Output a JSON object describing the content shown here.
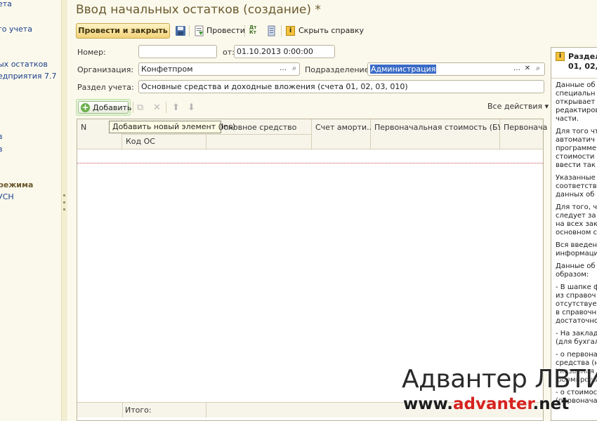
{
  "left_nav": {
    "items": [
      "ета",
      "го учета",
      "ых остатков",
      "едприятия 7.7",
      "в",
      "в"
    ],
    "section": "режима",
    "section_item": "УСН"
  },
  "form": {
    "title": "Ввод начальных остатков (создание) *",
    "toolbar": {
      "post_close": "Провести и закрыть",
      "save_icon": "floppy-disk-icon",
      "post": "Провести",
      "dt_kt": "Дт Кт",
      "hide_help": "Скрыть справку"
    },
    "number_label": "Номер:",
    "number_value": "",
    "date_label": "от:",
    "date_value": "01.10.2013  0:00:00",
    "org_label": "Организация:",
    "org_value": "Конфетпром",
    "dept_label": "Подразделение:",
    "dept_value": "Администрация",
    "section_label": "Раздел учета:",
    "section_value": "Основные средства и доходные вложения (счета 01, 02, 03, 010)"
  },
  "table": {
    "add_label": "Добавить",
    "all_actions": "Все действия",
    "tooltip": "Добавить новый элемент (Ins)",
    "columns": [
      "N",
      "Основное средство",
      "Счет аморти...",
      "Первоначальная стоимость (БУ)",
      "Первонача"
    ],
    "subcolumns": [
      "Код ОС"
    ],
    "footer_total": "Итого:"
  },
  "help": {
    "title_line1": "Раздел",
    "title_line2": "01, 02,",
    "paragraphs": [
      "Данные об\nспециальн\nоткрывает\nредактиров\nчасти.",
      "Для того чт\nавтоматич\nпрограмме\nстоимости\nввести так",
      "Указанные\nсоответств\nданных об с",
      "Для того, ч\nследует за\nна всех зак\nосновном с",
      "Вся введен\nинформаци",
      "Данные об\nобразом:",
      "- В шапке ф\nиз справоч\nотсутствует\nв справочни\nдостаточно",
      "- На заклад\n(для бухгал",
      "- о первона\nсредства (на\nУказанная\nформирова",
      "- о стоимос\n(первонача"
    ]
  },
  "watermark": {
    "brand": "Адвантер ЛВТИ",
    "url_prefix": "www.",
    "url_accent": "advanter",
    "url_suffix": ".net"
  },
  "colors": {
    "title": "#6b5a2e",
    "primary_button": "#f2d27a",
    "selection": "#3b6bc7",
    "add_highlight": "#e6f3da",
    "brand_red": "#d6231f"
  }
}
